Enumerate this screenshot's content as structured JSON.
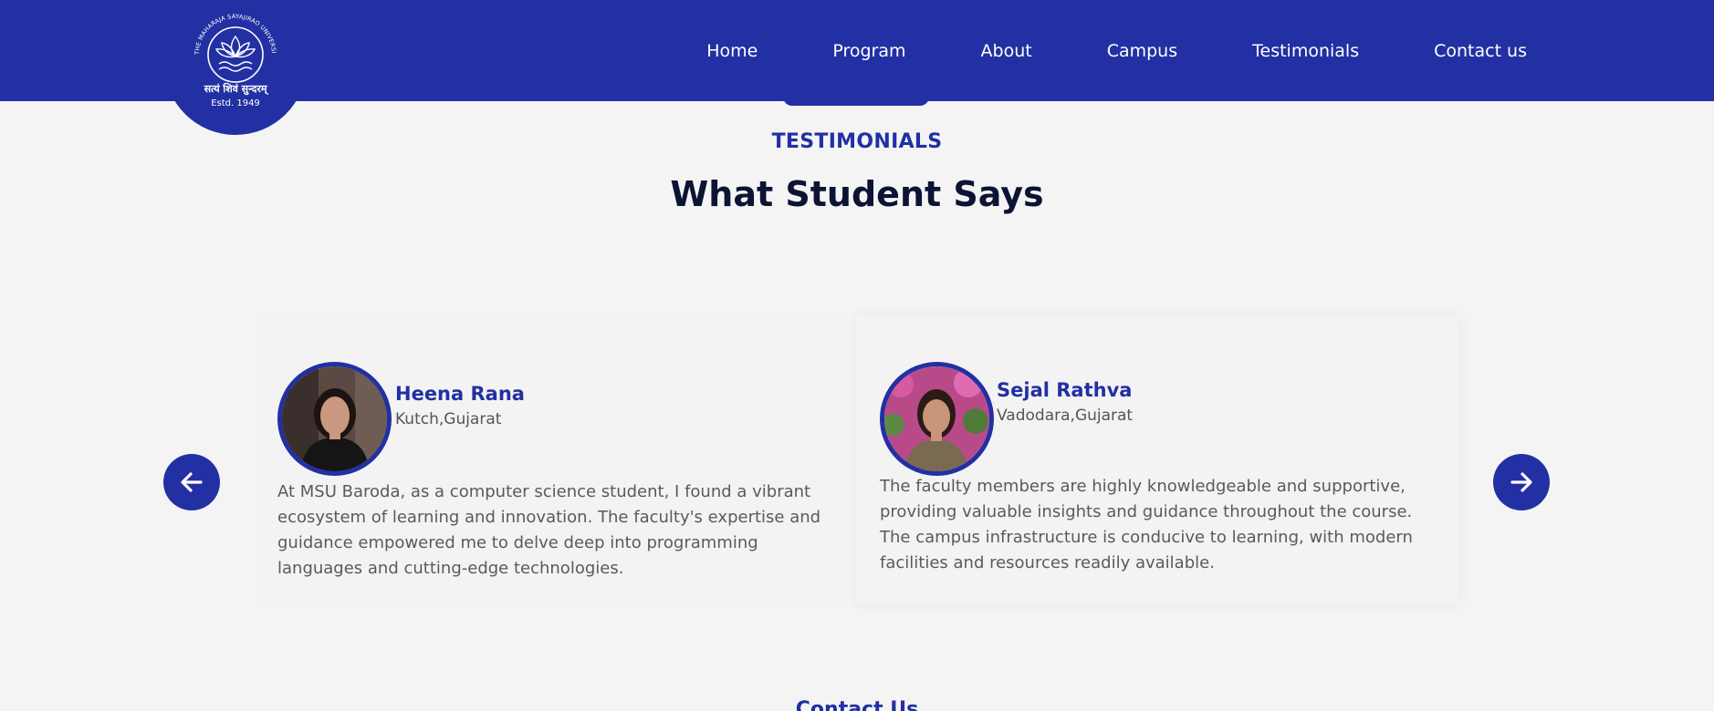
{
  "logo": {
    "ring_text": "THE MAHARAJA SAYAJIRAO UNIVERSITY OF BARODA",
    "motto": "सत्यं शिवं सुन्दरम्",
    "established": "Estd. 1949"
  },
  "nav": {
    "items": [
      "Home",
      "Program",
      "About",
      "Campus",
      "Testimonials",
      "Contact us"
    ]
  },
  "section": {
    "eyebrow": "TESTIMONIALS",
    "title": "What Student Says"
  },
  "testimonials": [
    {
      "name": "Heena Rana",
      "location": "Kutch,Gujarat",
      "quote": "At MSU Baroda, as a computer science student, I found a vibrant ecosystem of learning and innovation. The faculty's expertise and guidance empowered me to delve deep into programming languages and cutting-edge technologies."
    },
    {
      "name": "Sejal Rathva",
      "location": "Vadodara,Gujarat",
      "quote": "The faculty members are highly knowledgeable and supportive, providing valuable insights and guidance throughout the course. The campus infrastructure is conducive to learning, with modern facilities and resources readily available."
    }
  ],
  "controls": {
    "prev_icon": "arrow-left-icon",
    "next_icon": "arrow-right-icon"
  },
  "next_section": {
    "title": "Contact Us"
  },
  "colors": {
    "brand": "#2230a3",
    "heading": "#0c1433",
    "background": "#f4f4f4"
  }
}
